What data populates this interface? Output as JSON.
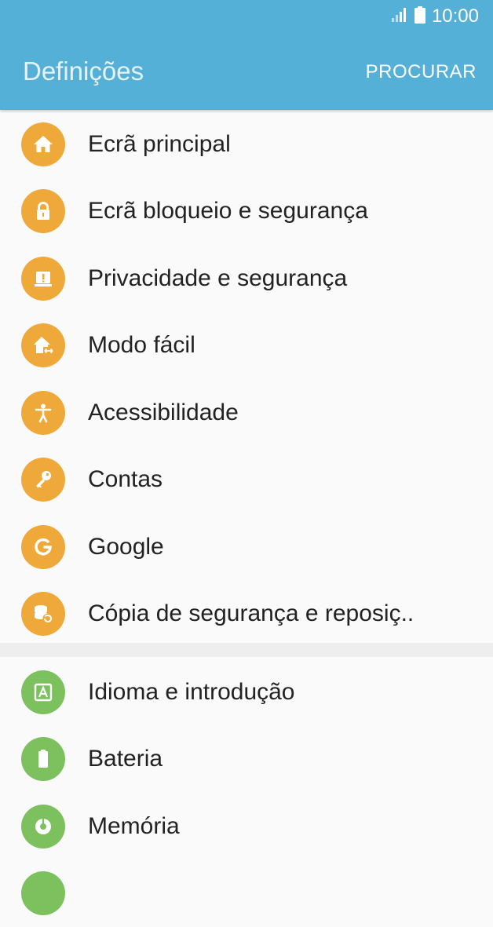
{
  "status_bar": {
    "time": "10:00",
    "icons": [
      "signal-icon",
      "battery-icon"
    ]
  },
  "app_bar": {
    "title": "Definições",
    "action": "PROCURAR",
    "color": "#55b0d8"
  },
  "colors": {
    "orange": "#efa93b",
    "green": "#7dc15e"
  },
  "section_one": {
    "items": [
      {
        "label": "Ecrã principal",
        "icon": "home-icon"
      },
      {
        "label": "Ecrã bloqueio e segurança",
        "icon": "lock-icon"
      },
      {
        "label": "Privacidade e segurança",
        "icon": "privacy-icon"
      },
      {
        "label": "Modo fácil",
        "icon": "easy-mode-icon"
      },
      {
        "label": "Acessibilidade",
        "icon": "accessibility-icon"
      },
      {
        "label": "Contas",
        "icon": "key-icon"
      },
      {
        "label": "Google",
        "icon": "google-icon"
      },
      {
        "label": "Cópia de segurança e reposiç..",
        "icon": "backup-icon"
      }
    ]
  },
  "section_two": {
    "items": [
      {
        "label": "Idioma e introdução",
        "icon": "language-icon"
      },
      {
        "label": "Bateria",
        "icon": "battery-settings-icon"
      },
      {
        "label": "Memória",
        "icon": "storage-icon"
      }
    ]
  }
}
